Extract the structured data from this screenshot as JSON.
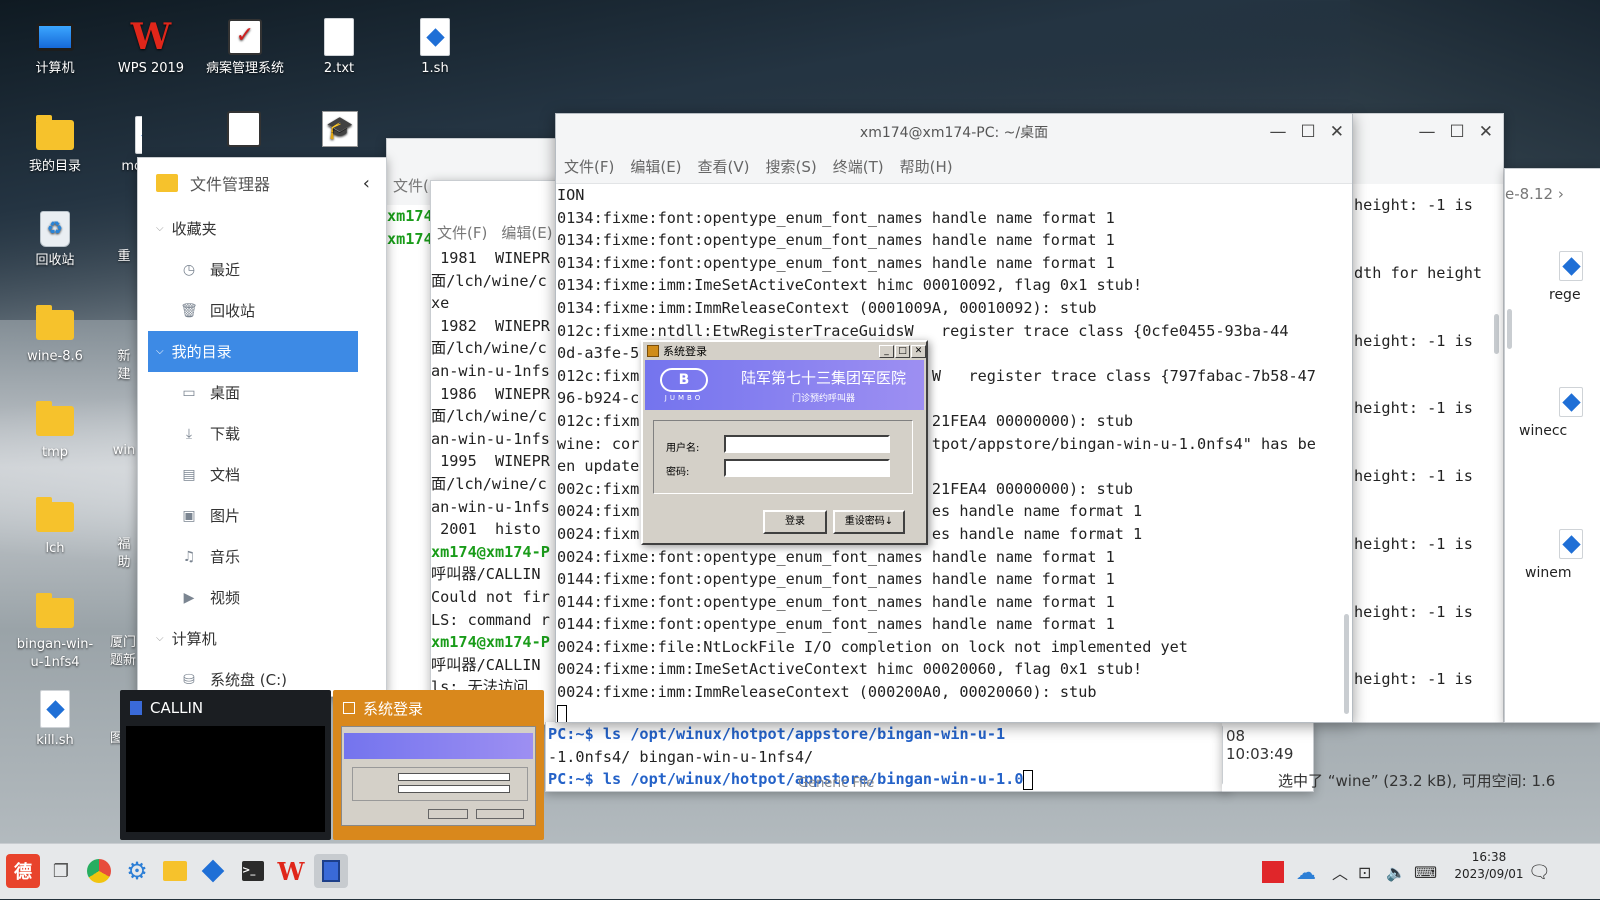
{
  "desktop_icons": [
    {
      "label": "计算机",
      "icon": "computer-icon"
    },
    {
      "label": "WPS 2019",
      "icon": "wps-icon"
    },
    {
      "label": "病案管理系统",
      "icon": "medical-record-icon"
    },
    {
      "label": "2.txt",
      "icon": "text-file-icon"
    },
    {
      "label": "1.sh",
      "icon": "script-file-icon"
    },
    {
      "label": "我的目录",
      "icon": "home-folder-icon"
    },
    {
      "label": "mo",
      "icon": "script-file-icon"
    },
    {
      "label": "回收站",
      "icon": "recycle-bin-icon"
    },
    {
      "label": "重",
      "icon": "app-icon"
    },
    {
      "label": "wine-8.6",
      "icon": "folder-icon"
    },
    {
      "label": "新建",
      "icon": "folder-icon"
    },
    {
      "label": "tmp",
      "icon": "folder-icon"
    },
    {
      "label": "win",
      "icon": "folder-icon"
    },
    {
      "label": "lch",
      "icon": "folder-icon"
    },
    {
      "label": "福助",
      "icon": "app-icon"
    },
    {
      "label": "bingan-win-u-1nfs4",
      "icon": "folder-icon"
    },
    {
      "label": "厦门题新",
      "icon": "app-icon"
    },
    {
      "label": "kill.sh",
      "icon": "script-file-icon"
    },
    {
      "label": "图题",
      "icon": "app-icon"
    }
  ],
  "file_manager": {
    "title": "文件管理器",
    "favorites": "收藏夹",
    "recent": "最近",
    "trash": "回收站",
    "my_dir": "我的目录",
    "desktop": "桌面",
    "downloads": "下载",
    "documents": "文档",
    "pictures": "图片",
    "music": "音乐",
    "videos": "视频",
    "computer": "计算机",
    "system_disk": "系统盘 (C:)"
  },
  "bg_window1": {
    "menu_file": "文件(",
    "lines": [
      "xm174",
      "xm174"
    ]
  },
  "bg_window2": {
    "menu": [
      "文件(F)",
      "编辑(E)"
    ],
    "lines": [
      " 1981  WINEPR",
      "面/lch/wine/c",
      "xe",
      " 1982  WINEPR",
      "面/lch/wine/c",
      "an-win-u-1nfs",
      " 1986  WINEPR",
      "面/lch/wine/c",
      "an-win-u-1nfs",
      " 1995  WINEPR",
      "面/lch/wine/c",
      "an-win-u-1nfs",
      " 2001  histo",
      "xm174@xm174-P",
      "呼叫器/CALLIN",
      "Could not fir",
      "LS: command r",
      "xm174@xm174-P",
      "呼叫器/CALLIN",
      "ls: 无法访问"
    ]
  },
  "bg_window3": {
    "lines": [
      "PC:~$ ls /opt/winux/hotpot/appstore/bingan-win-u-1",
      "-1.0nfs4/ bingan-win-u-1nfs4/",
      "PC:~$ ls /opt/winux/hotpot/appstore/bingan-win-u-1.0"
    ],
    "timestamp": "08 10:03:49",
    "generic_file": "Generic File",
    "status": "选中了 “wine” (23.2 kB), 可用空间: 1.6"
  },
  "terminal": {
    "title": "xm174@xm174-PC: ~/桌面",
    "menu": [
      "文件(F)",
      "编辑(E)",
      "查看(V)",
      "搜索(S)",
      "终端(T)",
      "帮助(H)"
    ],
    "lines": [
      "ION",
      "0134:fixme:font:opentype_enum_font_names handle name format 1",
      "0134:fixme:font:opentype_enum_font_names handle name format 1",
      "0134:fixme:font:opentype_enum_font_names handle name format 1",
      "0134:fixme:imm:ImeSetActiveContext himc 00010092, flag 0x1 stub!",
      "0134:fixme:imm:ImmReleaseContext (0001009A, 00010092): stub",
      "012c:fixme:ntdll:EtwRegisterTraceGuidsW   register trace class {0cfe0455-93ba-44",
      "0d-a3fe-5",
      "012c:fixm                                W   register trace class {797fabac-7b58-47",
      "96-b924-c",
      "012c:fixm                                21FEA4 00000000): stub",
      "wine: cor                                tpot/appstore/bingan-win-u-1.0nfs4\" has be",
      "en update",
      "002c:fixm                                21FEA4 00000000): stub",
      "0024:fixm                                es handle name format 1",
      "0024:fixm                                es handle name format 1",
      "0024:fixme:font:opentype_enum_font_names handle name format 1",
      "0144:fixme:font:opentype_enum_font_names handle name format 1",
      "0144:fixme:font:opentype_enum_font_names handle name format 1",
      "0144:fixme:font:opentype_enum_font_names handle name format 1",
      "0024:fixme:file:NtLockFile I/O completion on lock not implemented yet",
      "0024:fixme:imm:ImeSetActiveContext himc 00020060, flag 0x1 stub!",
      "0024:fixme:imm:ImmReleaseContext (000200A0, 00020060): stub"
    ]
  },
  "right_window": {
    "breadcrumb": "e-8.12",
    "lines": [
      "height: -1 is",
      "dth for height",
      "height: -1 is",
      "height: -1 is",
      "height: -1 is",
      "height: -1 is",
      "height: -1 is",
      "height: -1 is"
    ],
    "files": [
      "rege",
      "winecc",
      "winem"
    ]
  },
  "login_dialog": {
    "title": "系统登录",
    "hospital": "陆军第七十三集团军医院",
    "subtitle": "门诊预约呼叫器",
    "logo_text": "JUMBO",
    "username_label": "用户名:",
    "password_label": "密码:",
    "login_button": "登录",
    "reset_button": "重设密码↓"
  },
  "previews": {
    "callin": "CALLIN",
    "login": "系统登录"
  },
  "tray": {
    "time": "16:38",
    "date": "2023/09/01"
  },
  "colors": {
    "selection": "#3d8ae5",
    "login_banner": "#7c78ee",
    "preview_login_bg": "#d9881c"
  }
}
